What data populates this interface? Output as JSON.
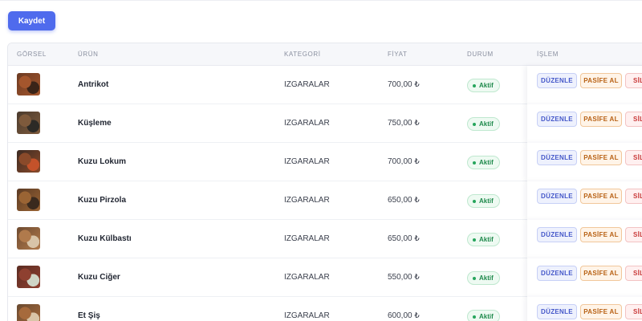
{
  "toolbar": {
    "save_label": "Kaydet"
  },
  "table": {
    "headers": {
      "image": "GÖRSEL",
      "product": "ÜRÜN",
      "category": "KATEGORİ",
      "price": "FİYAT",
      "status": "DURUM",
      "action": "İŞLEM"
    },
    "actions": {
      "edit": "DÜZENLE",
      "deactivate": "PASİFE AL",
      "delete": "SİL"
    },
    "rows": [
      {
        "name": "Antrikot",
        "category": "IZGARALAR",
        "price": "700,00 ₺",
        "status": "Aktif",
        "thumb_colors": [
          "#6b3a22",
          "#a4562d",
          "#3a2418"
        ]
      },
      {
        "name": "Küşleme",
        "category": "IZGARALAR",
        "price": "750,00 ₺",
        "status": "Aktif",
        "thumb_colors": [
          "#4a3b2e",
          "#7e5a3c",
          "#2c2a26"
        ]
      },
      {
        "name": "Kuzu Lokum",
        "category": "IZGARALAR",
        "price": "700,00 ₺",
        "status": "Aktif",
        "thumb_colors": [
          "#3b2a22",
          "#8a4a2a",
          "#c4522a"
        ]
      },
      {
        "name": "Kuzu Pirzola",
        "category": "IZGARALAR",
        "price": "650,00 ₺",
        "status": "Aktif",
        "thumb_colors": [
          "#5a3a24",
          "#9a6434",
          "#3a2a1e"
        ]
      },
      {
        "name": "Kuzu Külbastı",
        "category": "IZGARALAR",
        "price": "650,00 ₺",
        "status": "Aktif",
        "thumb_colors": [
          "#6e4a30",
          "#b07a4c",
          "#d8c4a8"
        ]
      },
      {
        "name": "Kuzu Ciğer",
        "category": "IZGARALAR",
        "price": "550,00 ₺",
        "status": "Aktif",
        "thumb_colors": [
          "#5b2c22",
          "#8e4030",
          "#cfd5c6"
        ]
      },
      {
        "name": "Et Şiş",
        "category": "IZGARALAR",
        "price": "600,00 ₺",
        "status": "Aktif",
        "thumb_colors": [
          "#6a4a30",
          "#a66a3c",
          "#d9c5a8"
        ]
      }
    ]
  }
}
